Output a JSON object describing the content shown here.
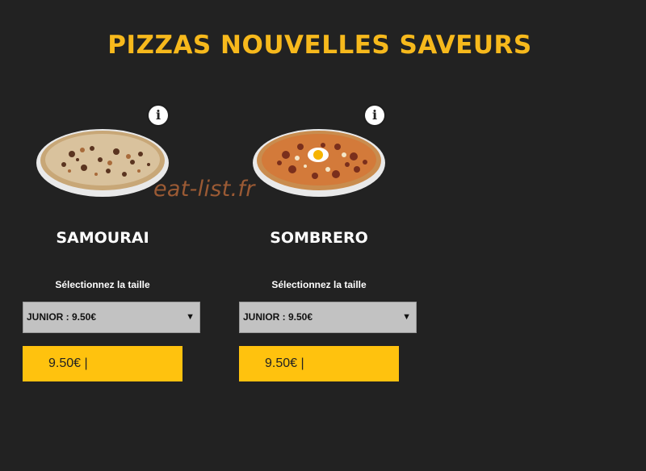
{
  "page": {
    "title": "PIZZAS NOUVELLES SAVEURS"
  },
  "watermark": "eat-list.fr",
  "info_glyph": "i",
  "colors": {
    "background": "#222222",
    "accent": "#f7b91c",
    "button": "#ffc20e",
    "select": "#c2c2c2"
  },
  "pizzas": [
    {
      "name": "SAMOURAI",
      "size_label": "Sélectionnez la taille",
      "selected_size": "JUNIOR : 9.50€",
      "price_label": "9.50€ |",
      "icon": "info-icon"
    },
    {
      "name": "SOMBRERO",
      "size_label": "Sélectionnez la taille",
      "selected_size": "JUNIOR : 9.50€",
      "price_label": "9.50€ |",
      "icon": "info-icon"
    }
  ]
}
